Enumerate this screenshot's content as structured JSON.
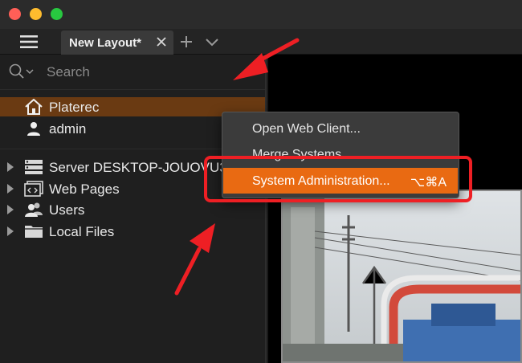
{
  "tabs": {
    "active_tab_label": "New Layout*"
  },
  "search": {
    "placeholder": "Search"
  },
  "tree": {
    "system": "Platerec",
    "user": "admin",
    "items": [
      {
        "label": "Server DESKTOP-JOUOVU3",
        "icon": "server-icon"
      },
      {
        "label": "Web Pages",
        "icon": "web-pages-icon"
      },
      {
        "label": "Users",
        "icon": "users-icon"
      },
      {
        "label": "Local Files",
        "icon": "folder-icon"
      }
    ]
  },
  "context_menu": {
    "items": [
      {
        "label": "Open Web Client..."
      },
      {
        "label": "Merge Systems..."
      },
      {
        "label": "System Administration...",
        "shortcut": "⌥⌘A",
        "active": true
      }
    ]
  },
  "colors": {
    "selected_row": "#6a3a12",
    "menu_active": "#e96a12",
    "annotation_red": "#ee1f24"
  }
}
